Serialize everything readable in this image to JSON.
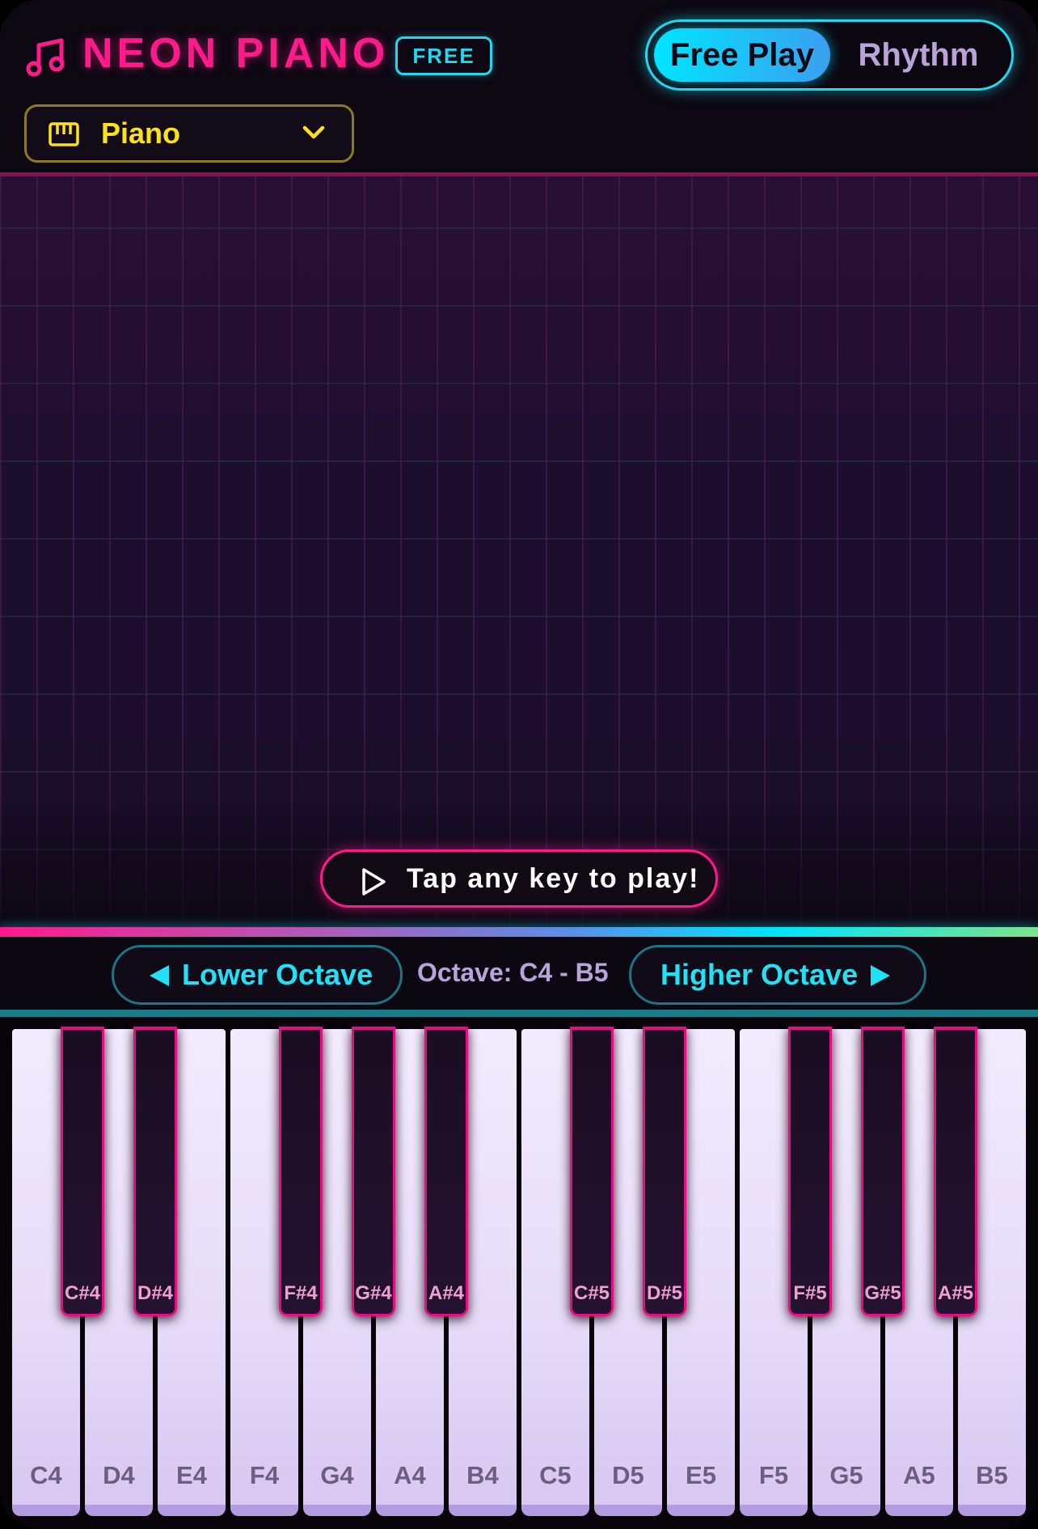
{
  "header": {
    "title": "NEON PIANO",
    "badge": "FREE",
    "modes": {
      "free_play": "Free Play",
      "rhythm": "Rhythm",
      "active": "Free Play"
    }
  },
  "instrument": {
    "selected": "Piano"
  },
  "stage": {
    "prompt": "Tap any key to play!"
  },
  "octave": {
    "lower": "Lower Octave",
    "range": "Octave: C4 - B5",
    "higher": "Higher Octave"
  },
  "keyboard": {
    "white_keys": [
      "C4",
      "D4",
      "E4",
      "F4",
      "G4",
      "A4",
      "B4",
      "C5",
      "D5",
      "E5",
      "F5",
      "G5",
      "A5",
      "B5"
    ],
    "black_keys": [
      "C#4",
      "D#4",
      "F#4",
      "G#4",
      "A#4",
      "C#5",
      "D#5",
      "F#5",
      "G#5",
      "A#5"
    ]
  },
  "colors": {
    "accent_pink": "#ff1a8c",
    "accent_cyan": "#22d8f0",
    "accent_yellow": "#ffe11a",
    "background": "#0d0812"
  },
  "icons": {
    "logo": "music-note-icon",
    "instrument": "piano-keys-icon",
    "dropdown": "chevron-down-icon",
    "prompt": "play-icon",
    "lower": "arrow-left-icon",
    "higher": "arrow-right-icon"
  }
}
